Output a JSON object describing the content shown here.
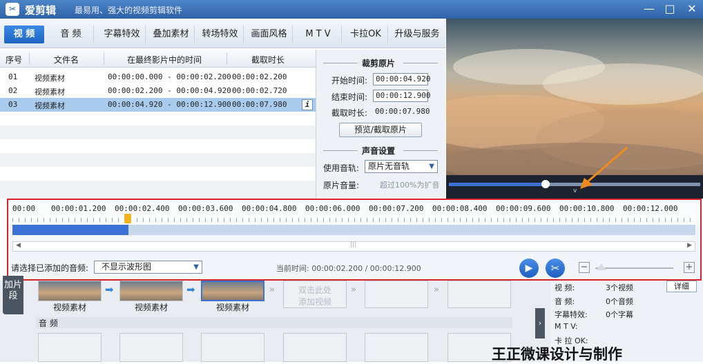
{
  "app": {
    "logo_char": "✂",
    "title": "爱剪辑",
    "slogan": "最易用、强大的视频剪辑软件"
  },
  "window_controls": {
    "minimize": "—",
    "maximize": "□",
    "close": "✕"
  },
  "tabs": [
    "视 频",
    "音 频",
    "字幕特效",
    "叠加素材",
    "转场特效",
    "画面风格",
    "M T V",
    "卡拉OK",
    "升级与服务"
  ],
  "table": {
    "headers": [
      "序号",
      "文件名",
      "在最终影片中的时间",
      "截取时长"
    ],
    "rows": [
      {
        "index": "01",
        "name": "视频素材",
        "time": "00:00:00.000 - 00:00:02.200",
        "duration": "00:00:02.200"
      },
      {
        "index": "02",
        "name": "视频素材",
        "time": "00:00:02.200 - 00:00:04.920",
        "duration": "00:00:02.720"
      },
      {
        "index": "03",
        "name": "视频素材",
        "time": "00:00:04.920 - 00:00:12.900",
        "duration": "00:00:07.980"
      }
    ],
    "info_icon": "i"
  },
  "trim_panel": {
    "title": "裁剪原片",
    "start_label": "开始时间:",
    "start_value": "00:00:04.920",
    "end_label": "结束时间:",
    "end_value": "00:00:12.900",
    "duration_label": "截取时长:",
    "duration_value": "00:00:07.980",
    "preview_button": "预览/截取原片"
  },
  "sound_panel": {
    "title": "声音设置",
    "track_label": "使用音轨:",
    "track_value": "原片无音轨",
    "volume_label": "原片音量:",
    "volume_hint": "超过100%为扩音"
  },
  "timeline": {
    "ticks": [
      "00:00",
      "00:00:01.200",
      "00:00:02.400",
      "00:00:03.600",
      "00:00:04.800",
      "00:00:06.000",
      "00:00:07.200",
      "00:00:08.400",
      "00:00:09.600",
      "00:00:10.800",
      "00:00:12.000"
    ],
    "progress_fraction": 0.17
  },
  "bottom_controls": {
    "audio_label": "请选择已添加的音频:",
    "audio_select": "不显示波形图",
    "current_time": "当前时间: 00:00:02.200 / 00:00:12.900",
    "zoom_out": "−",
    "zoom_in": "+"
  },
  "clips": {
    "side_tab": "加片段",
    "items": [
      "视频素材",
      "视频素材",
      "视频素材"
    ],
    "add_placeholder": "双击此处\n添加视频",
    "audio_section": "音 频"
  },
  "stats": {
    "video_label": "视   频:",
    "video_value": "3个视频",
    "detail_button": "详细",
    "audio_label": "音   频:",
    "audio_value": "0个音频",
    "subtitle_label": "字幕特效:",
    "subtitle_value": "0个字幕",
    "mtv_label": "M  T  V:",
    "karaoke_label": "卡 拉 OK:"
  },
  "watermark": "王正微课设计与制作",
  "colors": {
    "accent": "#1f64c2",
    "highlight_border": "#d8222a",
    "selected_row": "#a9ccee"
  }
}
